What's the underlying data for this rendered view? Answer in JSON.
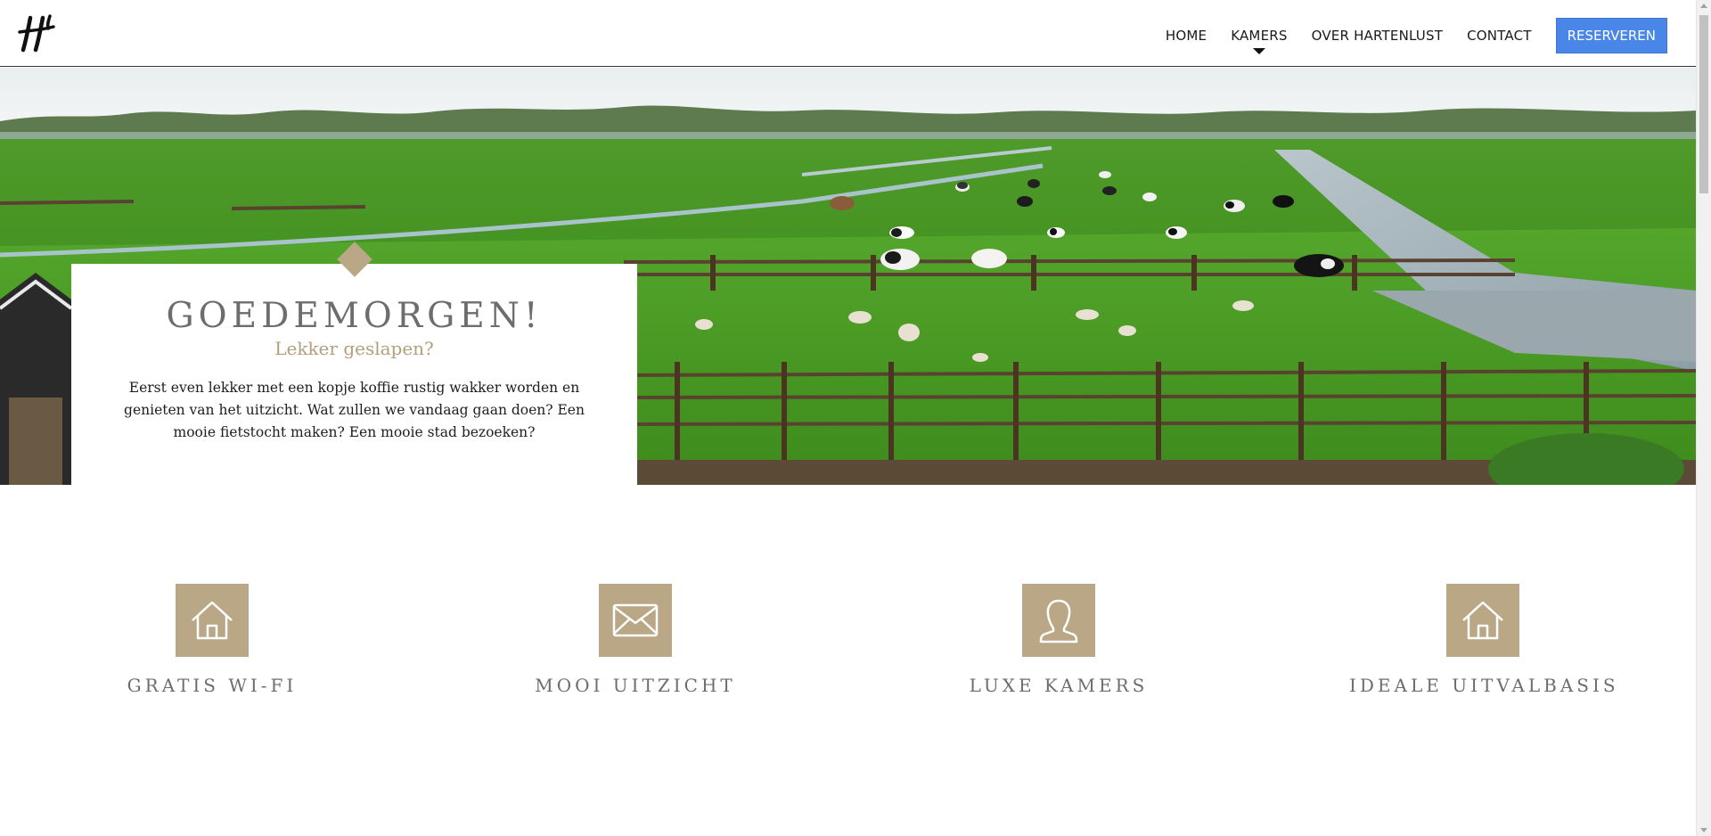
{
  "header": {
    "logo_icon": "hartenlust-logo",
    "nav": [
      {
        "label": "HOME"
      },
      {
        "label": "KAMERS",
        "has_dropdown": true
      },
      {
        "label": "OVER HARTENLUST"
      },
      {
        "label": "CONTACT"
      }
    ],
    "reserve_label": "RESERVEREN"
  },
  "hero": {
    "image": "polder-meadow-with-cows-and-sheep",
    "title": "GOEDEMORGEN!",
    "subtitle": "Lekker geslapen?",
    "text": "Eerst even lekker met een kopje koffie rustig wakker worden en genieten van het uitzicht. Wat zullen we vandaag gaan doen? Een mooie fietstocht maken? Een mooie stad bezoeken?"
  },
  "features": [
    {
      "icon": "house-icon",
      "label": "GRATIS WI-FI"
    },
    {
      "icon": "envelope-icon",
      "label": "MOOI UITZICHT"
    },
    {
      "icon": "person-icon",
      "label": "LUXE KAMERS"
    },
    {
      "icon": "house-icon",
      "label": "IDEALE UITVALBASIS"
    }
  ],
  "colors": {
    "accent": "#b9a785",
    "subtitle": "#b29f7b",
    "heading": "#6d6d6d",
    "button": "#4a86e8"
  }
}
